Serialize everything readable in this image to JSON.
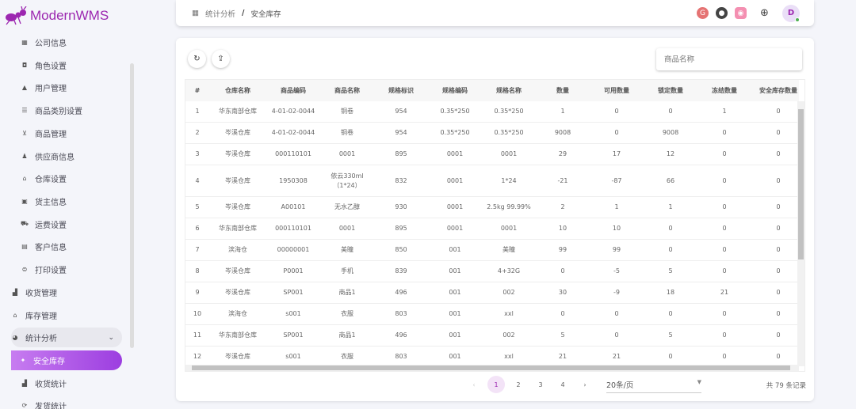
{
  "app": {
    "title": "ModernWMS"
  },
  "sidebar": {
    "children_top": [
      {
        "label": "公司信息",
        "icon": "building-icon",
        "g": "▦"
      },
      {
        "label": "角色设置",
        "icon": "badge-icon",
        "g": "◘"
      },
      {
        "label": "用户管理",
        "icon": "user-icon",
        "g": "▲"
      },
      {
        "label": "商品类别设置",
        "icon": "list-icon",
        "g": "☰"
      },
      {
        "label": "商品管理",
        "icon": "cart-icon",
        "g": "⊻"
      },
      {
        "label": "供应商信息",
        "icon": "supplier-icon",
        "g": "♟"
      },
      {
        "label": "仓库设置",
        "icon": "warehouse-icon",
        "g": "⌂"
      },
      {
        "label": "货主信息",
        "icon": "owner-icon",
        "g": "▣"
      },
      {
        "label": "运费设置",
        "icon": "truck-icon",
        "g": "⛟"
      },
      {
        "label": "客户信息",
        "icon": "customer-icon",
        "g": "▤"
      },
      {
        "label": "打印设置",
        "icon": "print-icon",
        "g": "⊜"
      }
    ],
    "groups": [
      {
        "label": "收货管理",
        "icon": "receive-icon",
        "g": "▟"
      },
      {
        "label": "库存管理",
        "icon": "inventory-icon",
        "g": "⌂"
      },
      {
        "label": "统计分析",
        "icon": "pie-chart-icon",
        "g": "◕"
      }
    ],
    "stats_children": [
      {
        "label": "安全库存",
        "icon": "star-icon",
        "g": "✦"
      },
      {
        "label": "收货统计",
        "icon": "receive-stats-icon",
        "g": "▟"
      },
      {
        "label": "发货统计",
        "icon": "ship-stats-icon",
        "g": "⟳"
      }
    ]
  },
  "breadcrumb": {
    "parent": "统计分析",
    "sep": "/",
    "current": "安全库存"
  },
  "search": {
    "placeholder": "商品名称"
  },
  "table": {
    "columns": [
      "#",
      "仓库名称",
      "商品编码",
      "商品名称",
      "规格标识",
      "规格编码",
      "规格名称",
      "数量",
      "可用数量",
      "锁定数量",
      "冻结数量",
      "安全库存数量"
    ],
    "rows": [
      [
        "1",
        "华东南部仓库",
        "4-01-02-0044",
        "铜卷",
        "954",
        "0.35*250",
        "0.35*250",
        "1",
        "0",
        "0",
        "1",
        "0"
      ],
      [
        "2",
        "岑溪仓库",
        "4-01-02-0044",
        "铜卷",
        "954",
        "0.35*250",
        "0.35*250",
        "9008",
        "0",
        "9008",
        "0",
        "0"
      ],
      [
        "3",
        "岑溪仓库",
        "000110101",
        "0001",
        "895",
        "0001",
        "0001",
        "29",
        "17",
        "12",
        "0",
        "0"
      ],
      [
        "4",
        "岑溪仓库",
        "1950308",
        "依云330ml（1*24）",
        "832",
        "0001",
        "1*24",
        "-21",
        "-87",
        "66",
        "0",
        "0"
      ],
      [
        "5",
        "岑溪仓库",
        "A00101",
        "无水乙醇",
        "930",
        "0001",
        "2.5kg 99.99%",
        "2",
        "1",
        "1",
        "0",
        "0"
      ],
      [
        "6",
        "华东南部仓库",
        "000110101",
        "0001",
        "895",
        "0001",
        "0001",
        "10",
        "10",
        "0",
        "0",
        "0"
      ],
      [
        "7",
        "滨海仓",
        "00000001",
        "美瞳",
        "850",
        "001",
        "美瞳",
        "99",
        "99",
        "0",
        "0",
        "0"
      ],
      [
        "8",
        "岑溪仓库",
        "P0001",
        "手机",
        "839",
        "001",
        "4+32G",
        "0",
        "-5",
        "5",
        "0",
        "0"
      ],
      [
        "9",
        "岑溪仓库",
        "SP001",
        "商品1",
        "496",
        "001",
        "002",
        "30",
        "-9",
        "18",
        "21",
        "0"
      ],
      [
        "10",
        "滨海仓",
        "s001",
        "衣服",
        "803",
        "001",
        "xxl",
        "0",
        "0",
        "0",
        "0",
        "0"
      ],
      [
        "11",
        "华东南部仓库",
        "SP001",
        "商品1",
        "496",
        "001",
        "002",
        "5",
        "0",
        "5",
        "0",
        "0"
      ],
      [
        "12",
        "岑溪仓库",
        "s001",
        "衣服",
        "803",
        "001",
        "xxl",
        "21",
        "21",
        "0",
        "0",
        "0"
      ]
    ]
  },
  "pagination": {
    "prev": "‹",
    "next": "›",
    "pages": [
      "1",
      "2",
      "3",
      "4"
    ],
    "current": "1",
    "page_size": "20条/页",
    "total": "共 79 条记录"
  },
  "colors": {
    "accent": "#9c27b0"
  }
}
